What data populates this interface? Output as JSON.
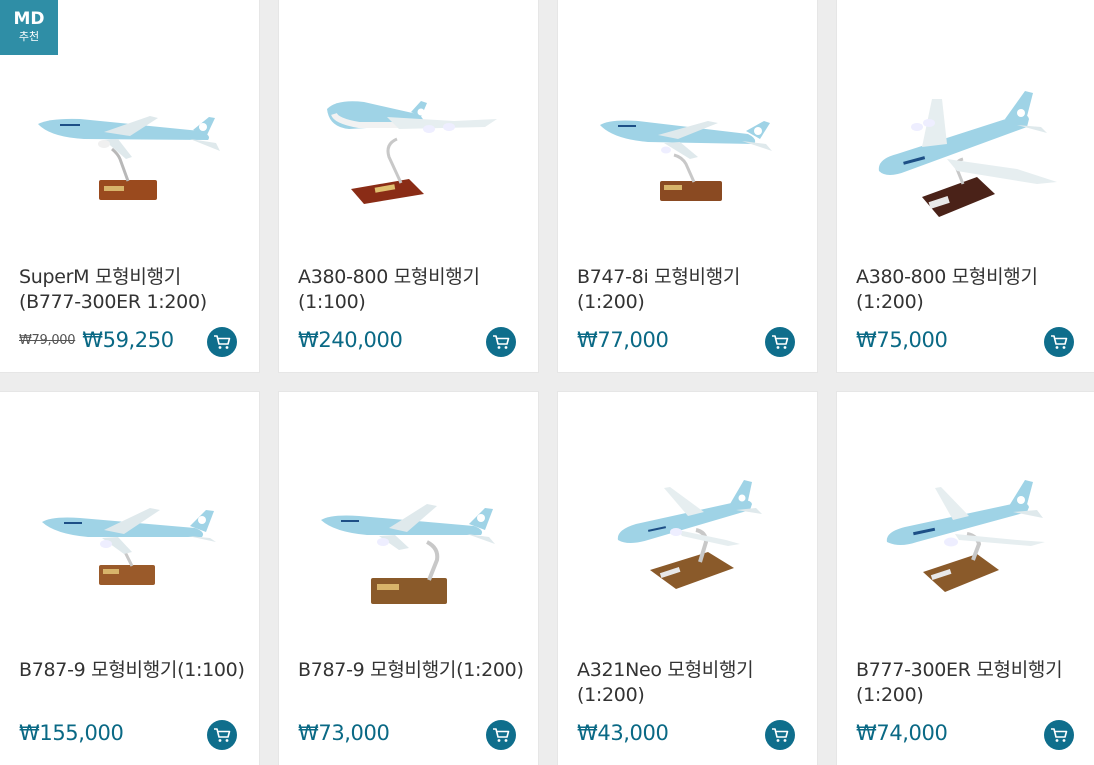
{
  "badge": {
    "big": "MD",
    "small": "추천"
  },
  "products": [
    {
      "title": "SuperM 모형비행기\n(B777-300ER 1:200)",
      "old_price": "₩79,000",
      "price": "₩59,250"
    },
    {
      "title": "A380-800 모형비행기\n(1:100)",
      "old_price": "",
      "price": "₩240,000"
    },
    {
      "title": "B747-8i 모형비행기\n(1:200)",
      "old_price": "",
      "price": "₩77,000"
    },
    {
      "title": "A380-800 모형비행기\n(1:200)",
      "old_price": "",
      "price": "₩75,000"
    },
    {
      "title": "B787-9 모형비행기(1:100)",
      "old_price": "",
      "price": "₩155,000"
    },
    {
      "title": "B787-9 모형비행기(1:200)",
      "old_price": "",
      "price": "₩73,000"
    },
    {
      "title": "A321Neo 모형비행기\n(1:200)",
      "old_price": "",
      "price": "₩43,000"
    },
    {
      "title": "B777-300ER 모형비행기\n(1:200)",
      "old_price": "",
      "price": "₩74,000"
    }
  ],
  "colors": {
    "accent": "#0a6985",
    "cart_button": "#0f6e8c",
    "badge": "#2f8ea6",
    "plane_body": "#9fd3e6"
  },
  "icons": {
    "cart": "shopping-cart-icon"
  }
}
